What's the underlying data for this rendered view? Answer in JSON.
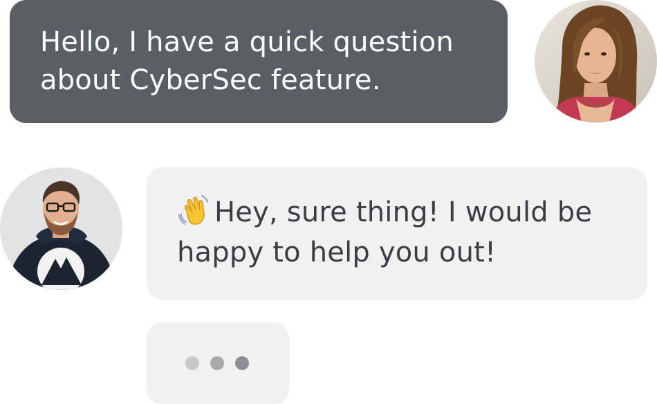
{
  "conversation": {
    "user_message": {
      "line1": "Hello, I have a quick question",
      "line2": "about CyberSec feature."
    },
    "agent_message": {
      "emoji": "waving-hand-icon",
      "line1": "Hey, sure thing! I would be",
      "line2": "happy to help you out!"
    },
    "typing_indicator": {
      "dots": 3
    }
  },
  "colors": {
    "user_bubble": "#5b5e64",
    "agent_bubble": "#f1f1f1",
    "dot_light": "#c5c5c5",
    "dot_mid": "#a8a8a8",
    "dot_dark": "#8a8c90"
  }
}
